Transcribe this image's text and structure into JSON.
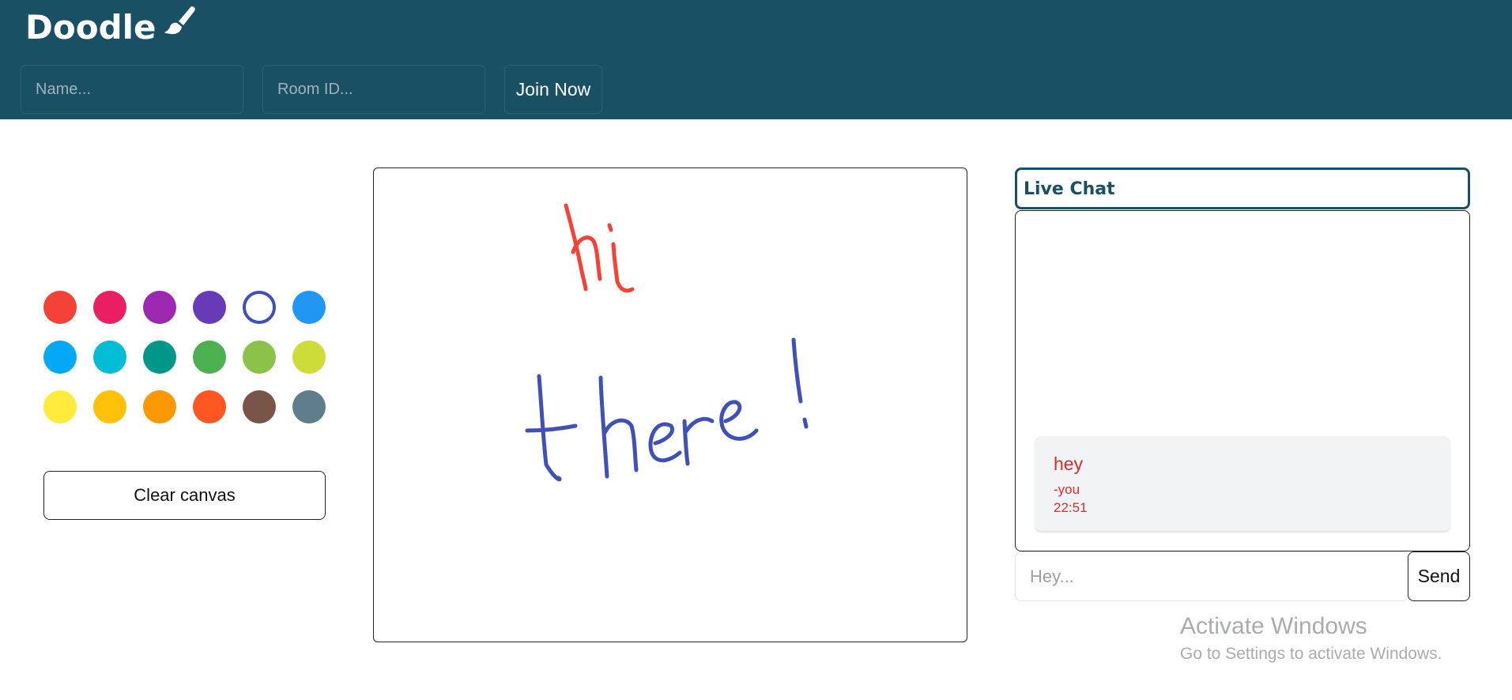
{
  "header": {
    "app_title": "Doodle",
    "brand_icon": "paintbrush-icon",
    "name_placeholder": "Name...",
    "room_placeholder": "Room ID...",
    "join_label": "Join Now",
    "background_color": "#1a5063"
  },
  "palette": {
    "colors": [
      "#f44336",
      "#e91e63",
      "#9c27b0",
      "#673ab7",
      "#3f51b5",
      "#2196f3",
      "#03a9f4",
      "#00bcd4",
      "#009688",
      "#4caf50",
      "#8bc34a",
      "#cddc39",
      "#ffeb3b",
      "#ffc107",
      "#ff9800",
      "#ff5722",
      "#795548",
      "#607d8b"
    ],
    "selected_color": "#3f51b5",
    "clear_label": "Clear canvas"
  },
  "canvas": {
    "strokes_colors": [
      "#f44336",
      "#3f51b5"
    ]
  },
  "chat": {
    "title": "Live Chat",
    "messages": [
      {
        "text": "hey",
        "author": "-you",
        "time": "22:51",
        "color": "#d32f2f"
      }
    ],
    "input_placeholder": "Hey...",
    "send_label": "Send"
  },
  "watermark": {
    "title": "Activate Windows",
    "subtitle": "Go to Settings to activate Windows."
  }
}
